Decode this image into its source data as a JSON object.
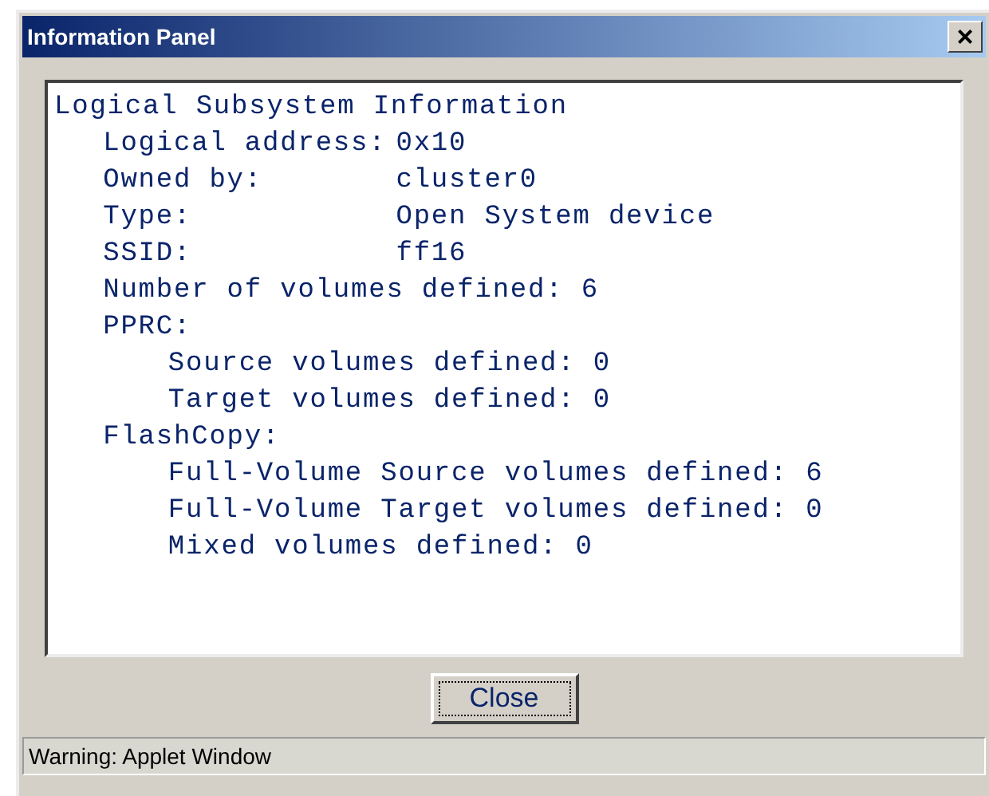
{
  "window": {
    "title": "Information Panel",
    "close_glyph": "×"
  },
  "info": {
    "heading": "Logical Subsystem Information",
    "children": [
      {
        "kind": "pair",
        "label": "Logical address:",
        "value": "0x10"
      },
      {
        "kind": "pair",
        "label": "Owned by:",
        "value": "cluster0"
      },
      {
        "kind": "pair",
        "label": "Type:",
        "value": "Open System device"
      },
      {
        "kind": "pair",
        "label": "SSID:",
        "value": "ff16"
      },
      {
        "kind": "line",
        "text": "Number of volumes defined: 6"
      },
      {
        "kind": "line",
        "text": "PPRC:",
        "children": [
          {
            "kind": "line",
            "text": "Source volumes defined: 0"
          },
          {
            "kind": "line",
            "text": "Target volumes defined: 0"
          }
        ]
      },
      {
        "kind": "line",
        "text": "FlashCopy:",
        "children": [
          {
            "kind": "line",
            "text": "Full-Volume Source volumes defined: 6"
          },
          {
            "kind": "line",
            "text": "Full-Volume Target volumes defined: 0"
          },
          {
            "kind": "line",
            "text": "Mixed volumes defined: 0"
          }
        ]
      }
    ]
  },
  "buttons": [
    {
      "label": "Close",
      "focused": true
    }
  ],
  "status_bar": "Warning: Applet Window"
}
